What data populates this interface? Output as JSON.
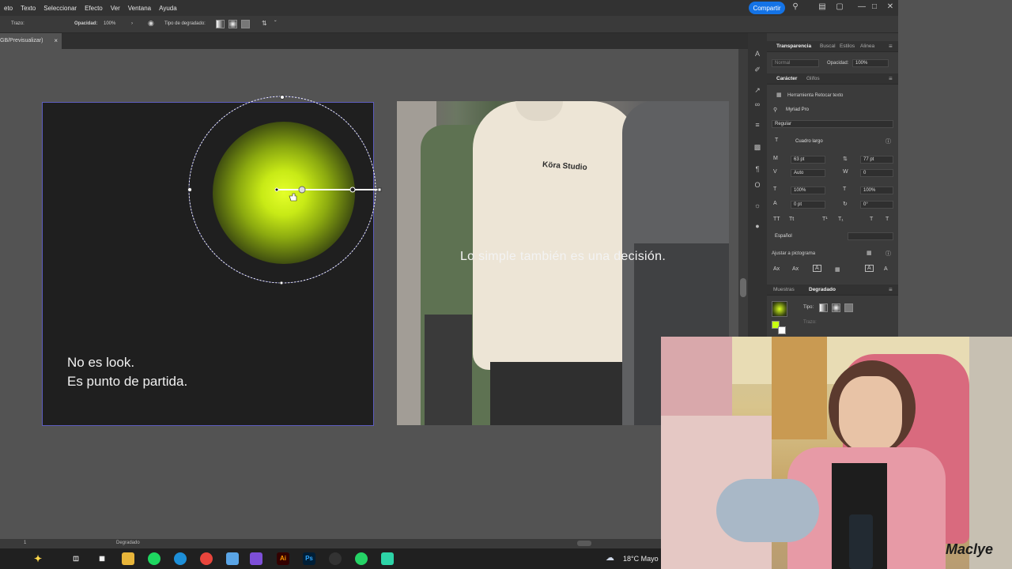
{
  "menu": {
    "items": [
      "eto",
      "Texto",
      "Seleccionar",
      "Efecto",
      "Ver",
      "Ventana",
      "Ayuda"
    ],
    "share_label": "Compartir"
  },
  "controlbar": {
    "stroke_label": "Trazo:",
    "opacity_label": "Opacidad:",
    "opacity_value": "100%",
    "gradient_type_label": "Tipo de degradado:"
  },
  "document": {
    "tab_label": "GB/Previsualizar)",
    "close_glyph": "×"
  },
  "artboard1": {
    "line1": "No es look.",
    "line2": "Es punto de partida.",
    "glow_color": "#e4ff2a"
  },
  "artboard2": {
    "overlay_text": "Lo simple también es una decisión.",
    "brand_print": "Köra Studio"
  },
  "panels": {
    "transparency_tabs": [
      "Transparencia",
      "Buscal",
      "Estilos",
      "Alinea"
    ],
    "blend_mode": "Normal",
    "opacity_label": "Opacidad:",
    "opacity_value": "100%",
    "character_tabs": [
      "Carácter",
      "Glifos"
    ],
    "touch_type_label": "Herramienta Retocar texto",
    "font_family": "Myriad Pro",
    "font_style": "Regular",
    "size_option": "Cuadro largo",
    "font_size": "63 pt",
    "leading": "77 pt",
    "kerning": "Auto",
    "tracking": "0",
    "vscale": "100%",
    "hscale": "100%",
    "baseline": "0 pt",
    "rotation": "0°",
    "language": "Español",
    "snap_label": "Ajustar a pictograma",
    "bottom_tabs": [
      "Muestras",
      "Degradado"
    ],
    "gradient_type_label": "Tipo:",
    "stroke_label": "Trazo:"
  },
  "statusbar": {
    "zoom": "1",
    "tool_label": "Degradado"
  },
  "taskbar": {
    "weather": "18°C  Mayo"
  },
  "webcam": {
    "watermark": "Maclye"
  },
  "colors": {
    "accent": "#1473e6",
    "artboard_bg": "#1f1f1f",
    "canvas_bg": "#535353",
    "selection": "#5d5dbf"
  }
}
